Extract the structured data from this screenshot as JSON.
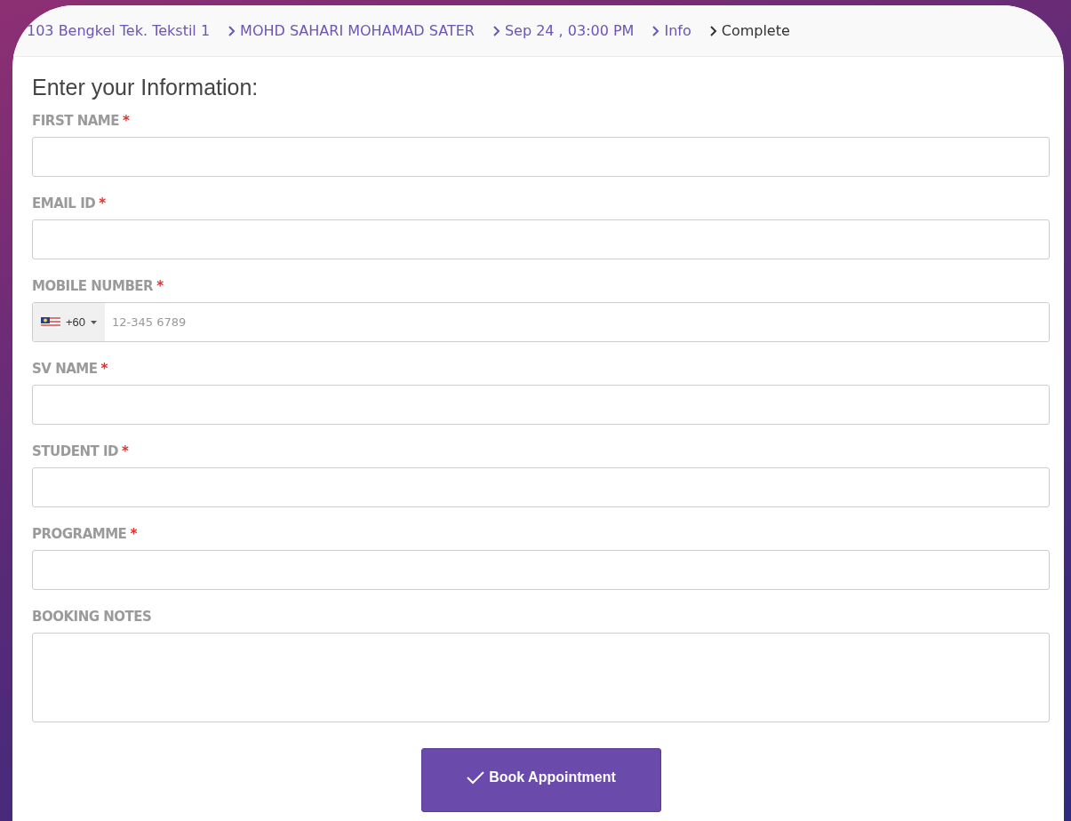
{
  "breadcrumb": [
    {
      "label": "103 Bengkel Tek. Tekstil 1",
      "selected": false
    },
    {
      "label": "MOHD SAHARI MOHAMAD SATER",
      "selected": false
    },
    {
      "label": "Sep 24 , 03:00 PM",
      "selected": false
    },
    {
      "label": "Info",
      "selected": false
    },
    {
      "label": "Complete",
      "selected": true
    }
  ],
  "heading": "Enter your Information:",
  "fields": [
    {
      "kind": "text",
      "label": "FIRST NAME",
      "required_mark": "*"
    },
    {
      "kind": "text",
      "label": "EMAIL ID",
      "required_mark": "*"
    },
    {
      "kind": "phone",
      "label": "MOBILE NUMBER",
      "required_mark": "*",
      "country_code": "+60",
      "placeholder": "12-345 6789"
    },
    {
      "kind": "text",
      "label": "SV NAME",
      "required_mark": "*"
    },
    {
      "kind": "text",
      "label": "STUDENT ID",
      "required_mark": "*"
    },
    {
      "kind": "text",
      "label": "PROGRAMME",
      "required_mark": "*"
    },
    {
      "kind": "textarea",
      "label": "BOOKING NOTES"
    }
  ],
  "submit": {
    "label": "Book Appointment"
  }
}
